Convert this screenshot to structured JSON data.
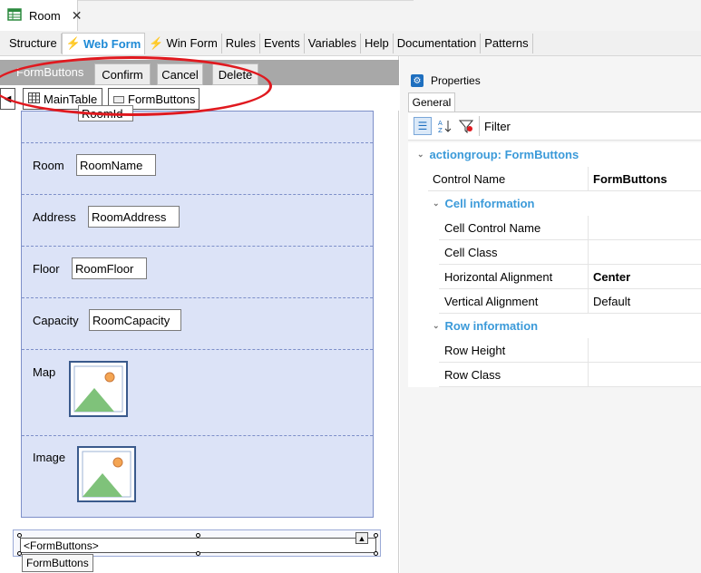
{
  "doc_tab": {
    "title": "Room",
    "close": "✕"
  },
  "editor_tabs": [
    "Structure",
    "Web Form",
    "Win Form",
    "Rules",
    "Events",
    "Variables",
    "Help",
    "Documentation",
    "Patterns"
  ],
  "designer": {
    "fb_title": "FormButtons",
    "buttons": [
      "Confirm",
      "Cancel",
      "Delete"
    ],
    "crumbs": [
      "MainTable",
      "FormButtons"
    ],
    "fields": [
      {
        "label": "Room",
        "value": "RoomId"
      },
      {
        "label": "Room",
        "value": "RoomName"
      },
      {
        "label": "Address",
        "value": "RoomAddress"
      },
      {
        "label": "Floor",
        "value": "RoomFloor"
      },
      {
        "label": "Capacity",
        "value": "RoomCapacity"
      },
      {
        "label": "Map"
      },
      {
        "label": "Image"
      }
    ],
    "fb_selected": "<FormButtons>",
    "tooltip": "FormButtons"
  },
  "properties": {
    "title": "Properties",
    "tab": "General",
    "filter": "Filter",
    "section_main": "actiongroup: FormButtons",
    "control_name": {
      "name": "Control Name",
      "value": "FormButtons"
    },
    "cell_section": "Cell information",
    "cell_rows": [
      {
        "name": "Cell Control Name",
        "value": ""
      },
      {
        "name": "Cell Class",
        "value": ""
      },
      {
        "name": "Horizontal Alignment",
        "value": "Center"
      },
      {
        "name": "Vertical Alignment",
        "value": "Default"
      }
    ],
    "row_section": "Row information",
    "row_rows": [
      {
        "name": "Row Height",
        "value": ""
      },
      {
        "name": "Row Class",
        "value": ""
      }
    ]
  },
  "colors": {
    "accent": "#1e8ad6",
    "section": "#3b9ad9",
    "annotation": "#e0191f",
    "form_bg": "#dce3f7"
  },
  "icons": [
    "table-icon",
    "lightning-icon",
    "image-placeholder-icon",
    "properties-icon",
    "filter-icon"
  ]
}
